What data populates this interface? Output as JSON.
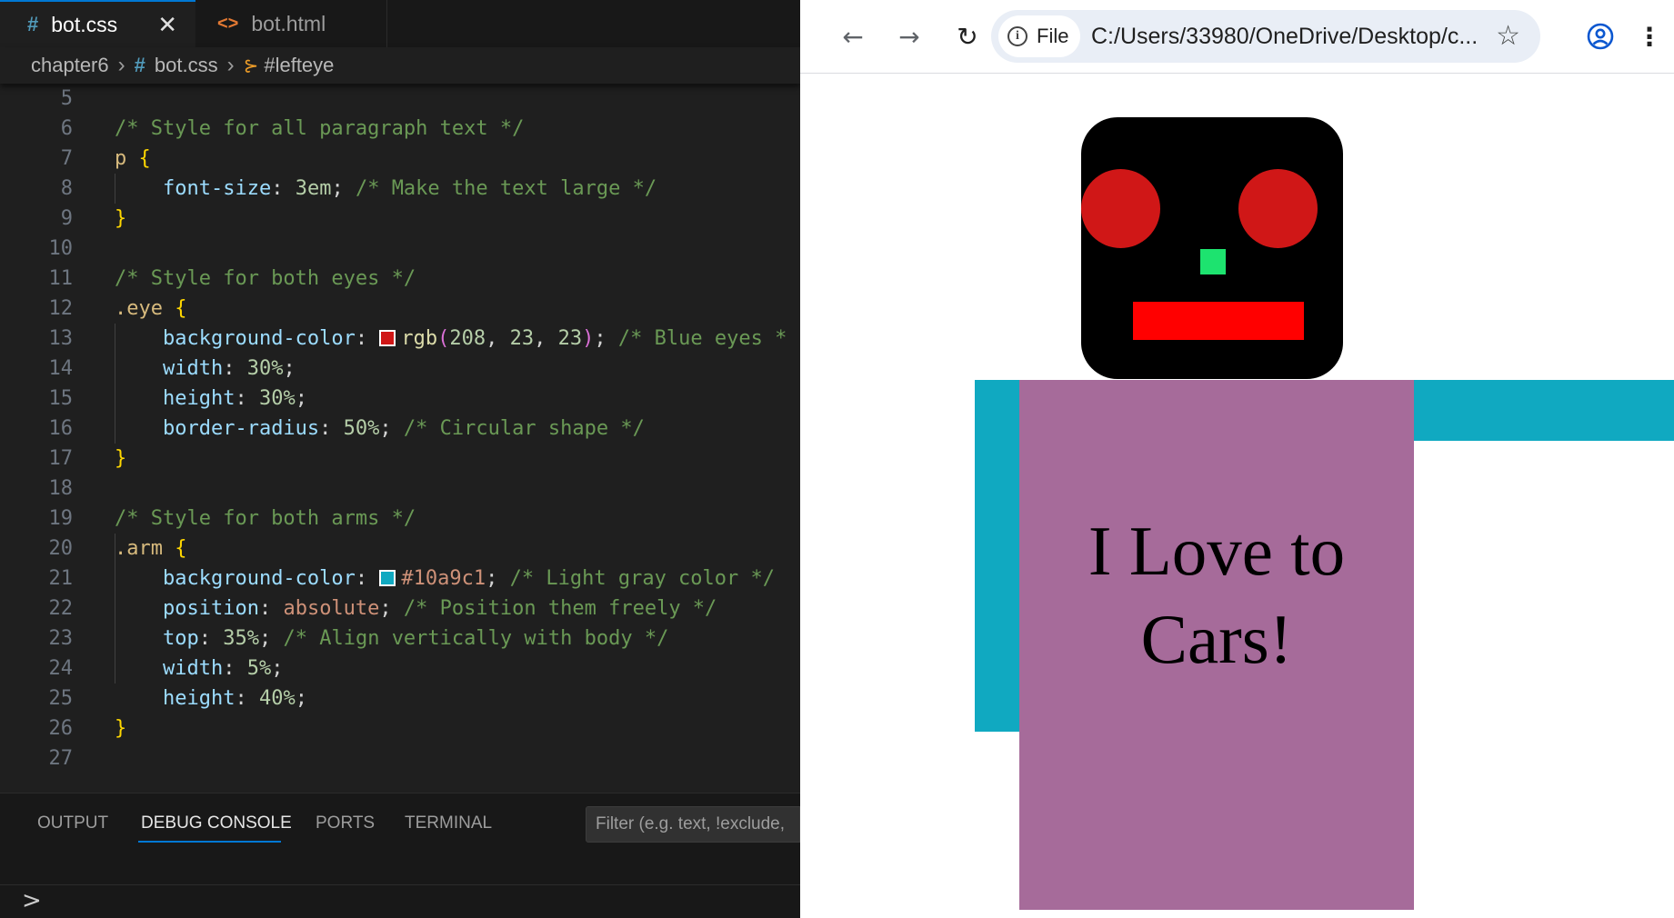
{
  "editor": {
    "tabs": [
      {
        "label": "bot.css",
        "icon": "css-hash-icon",
        "active": true
      },
      {
        "label": "bot.html",
        "icon": "html-brackets-icon",
        "active": false
      }
    ],
    "close_glyph": "✕",
    "breadcrumb": {
      "folder": "chapter6",
      "file": "bot.css",
      "symbol": "#lefteye"
    },
    "lines": [
      {
        "n": "5",
        "text": ""
      },
      {
        "n": "6",
        "text": "/* Style for all paragraph text */"
      },
      {
        "n": "7",
        "text": "p {"
      },
      {
        "n": "8",
        "text": "    font-size: 3em; /* Make the text large */"
      },
      {
        "n": "9",
        "text": "}"
      },
      {
        "n": "10",
        "text": ""
      },
      {
        "n": "11",
        "text": "/* Style for both eyes */"
      },
      {
        "n": "12",
        "text": ".eye {"
      },
      {
        "n": "13",
        "text": "    background-color: rgb(208, 23, 23); /* Blue eyes *"
      },
      {
        "n": "14",
        "text": "    width: 30%;"
      },
      {
        "n": "15",
        "text": "    height: 30%;"
      },
      {
        "n": "16",
        "text": "    border-radius: 50%; /* Circular shape */"
      },
      {
        "n": "17",
        "text": "}"
      },
      {
        "n": "18",
        "text": ""
      },
      {
        "n": "19",
        "text": "/* Style for both arms */"
      },
      {
        "n": "20",
        "text": ".arm {"
      },
      {
        "n": "21",
        "text": "    background-color: #10a9c1; /* Light gray color */"
      },
      {
        "n": "22",
        "text": "    position: absolute; /* Position them freely */"
      },
      {
        "n": "23",
        "text": "    top: 35%; /* Align vertically with body */"
      },
      {
        "n": "24",
        "text": "    width: 5%;"
      },
      {
        "n": "25",
        "text": "    height: 40%;"
      },
      {
        "n": "26",
        "text": "}"
      },
      {
        "n": "27",
        "text": ""
      }
    ],
    "swatches": {
      "eye": "#d01717",
      "arm": "#10a9c1"
    },
    "panel": {
      "tabs": [
        "OUTPUT",
        "DEBUG CONSOLE",
        "PORTS",
        "TERMINAL"
      ],
      "active_tab": "DEBUG CONSOLE",
      "filter_placeholder": "Filter (e.g. text, !exclude,",
      "prompt": ">"
    }
  },
  "browser": {
    "nav": {
      "back": "←",
      "forward": "→",
      "reload": "↻"
    },
    "site_chip": "File",
    "url": "C:/Users/33980/OneDrive/Desktop/c...",
    "star": "☆",
    "menu": "⋮",
    "page": {
      "body_text": "I Love to Cars!",
      "colors": {
        "head": "#000000",
        "eye": "#d01717",
        "nose": "#1de36f",
        "mouth": "#ff0000",
        "arm": "#10a9c1",
        "body": "#a66b9a"
      }
    }
  }
}
